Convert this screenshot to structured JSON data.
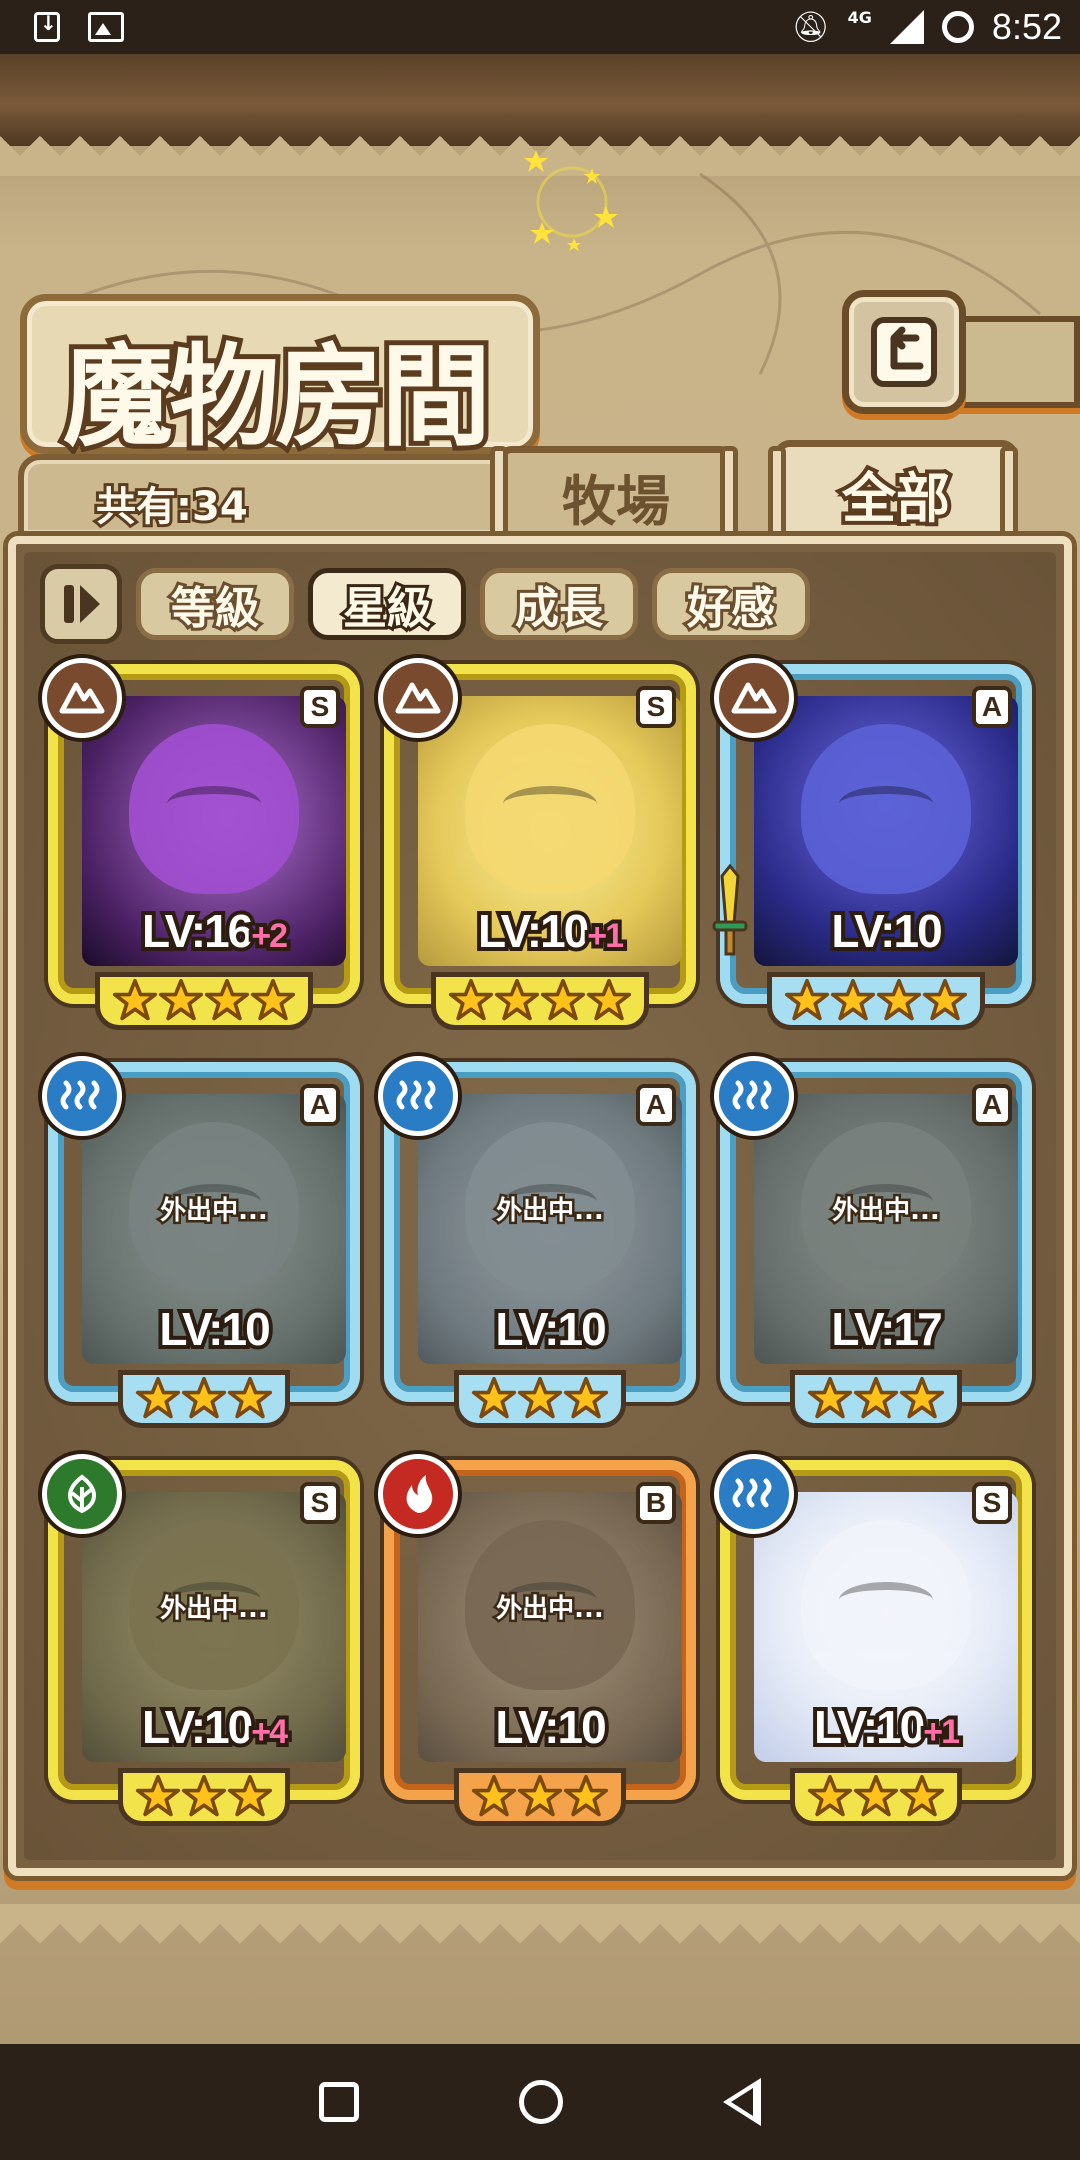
{
  "status_bar": {
    "time": "8:52",
    "network": "4G",
    "icons": [
      "download-icon",
      "image-icon",
      "notifications-off-icon",
      "signal-icon",
      "sync-icon"
    ]
  },
  "header": {
    "title": "魔物房間",
    "back_icon": "return-icon"
  },
  "summary": {
    "count_label": "共有:34"
  },
  "tabs": [
    {
      "label": "牧場",
      "active": false
    },
    {
      "label": "全部",
      "active": true
    }
  ],
  "sort": {
    "toggle_icon": "pause-sort-icon",
    "buttons": [
      {
        "label": "等級",
        "active": false
      },
      {
        "label": "星級",
        "active": true
      },
      {
        "label": "成長",
        "active": false
      },
      {
        "label": "好感",
        "active": false
      }
    ]
  },
  "monsters": [
    {
      "level": "LV:16",
      "plus": "+2",
      "rank": "S",
      "element": "earth",
      "stars": 4,
      "frame": "gold",
      "away_label": "",
      "portrait_color": "#a24fd1",
      "weapon": false
    },
    {
      "level": "LV:10",
      "plus": "+1",
      "rank": "S",
      "element": "earth",
      "stars": 4,
      "frame": "gold",
      "away_label": "",
      "portrait_color": "#f5d870",
      "weapon": false
    },
    {
      "level": "LV:10",
      "plus": "",
      "rank": "A",
      "element": "earth",
      "stars": 4,
      "frame": "blue",
      "away_label": "",
      "portrait_color": "#5b62d6",
      "weapon": true
    },
    {
      "level": "LV:10",
      "plus": "",
      "rank": "A",
      "element": "water",
      "stars": 3,
      "frame": "blue",
      "away_label": "外出中...",
      "portrait_color": "#8a9491",
      "weapon": false
    },
    {
      "level": "LV:10",
      "plus": "",
      "rank": "A",
      "element": "water",
      "stars": 3,
      "frame": "blue",
      "away_label": "外出中...",
      "portrait_color": "#98a3ab",
      "weapon": false
    },
    {
      "level": "LV:17",
      "plus": "",
      "rank": "A",
      "element": "water",
      "stars": 3,
      "frame": "blue",
      "away_label": "外出中...",
      "portrait_color": "#8a918b",
      "weapon": false
    },
    {
      "level": "LV:10",
      "plus": "+4",
      "rank": "S",
      "element": "wood",
      "stars": 3,
      "frame": "gold",
      "away_label": "外出中...",
      "portrait_color": "#8d7a45",
      "weapon": false
    },
    {
      "level": "LV:10",
      "plus": "",
      "rank": "B",
      "element": "fire",
      "stars": 3,
      "frame": "orange",
      "away_label": "外出中...",
      "portrait_color": "#8a6a4a",
      "weapon": false
    },
    {
      "level": "LV:10",
      "plus": "+1",
      "rank": "S",
      "element": "water",
      "stars": 3,
      "frame": "gold",
      "away_label": "",
      "portrait_color": "#f2f4fb",
      "weapon": false
    }
  ],
  "nav": {
    "items": [
      "recents-button",
      "home-button",
      "back-button"
    ]
  }
}
